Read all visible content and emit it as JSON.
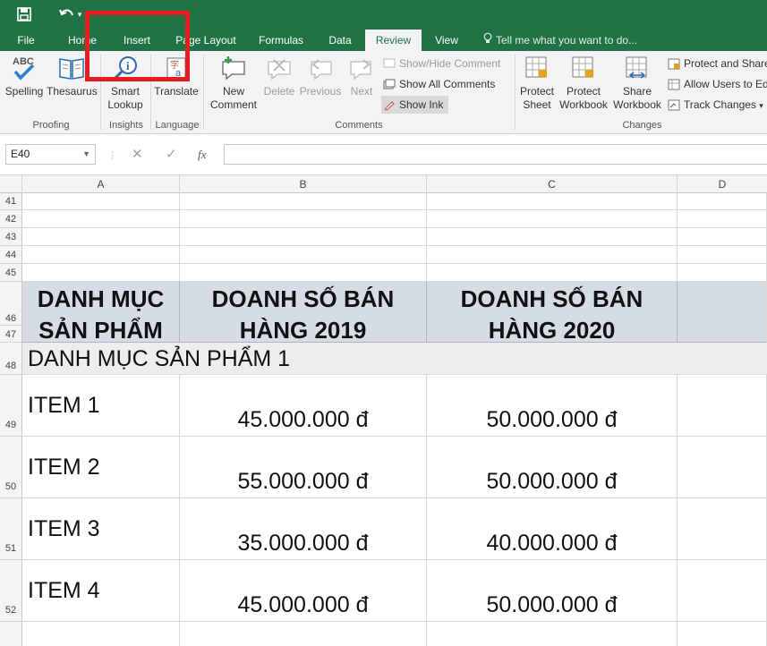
{
  "title_bar": {
    "save_icon": "save-icon",
    "undo_icon": "undo-icon"
  },
  "tabs": [
    {
      "label": "File"
    },
    {
      "label": "Home"
    },
    {
      "label": "Insert"
    },
    {
      "label": "Page Layout"
    },
    {
      "label": "Formulas"
    },
    {
      "label": "Data"
    },
    {
      "label": "Review"
    },
    {
      "label": "View"
    }
  ],
  "tell_me": "Tell me what you want to do...",
  "ribbon": {
    "proofing": {
      "label": "Proofing",
      "spelling": "Spelling",
      "thesaurus": "Thesaurus"
    },
    "insights": {
      "label": "Insights",
      "smart_lookup_1": "Smart",
      "smart_lookup_2": "Lookup"
    },
    "language": {
      "label": "Language",
      "translate": "Translate"
    },
    "comments": {
      "label": "Comments",
      "new_comment_1": "New",
      "new_comment_2": "Comment",
      "delete": "Delete",
      "previous": "Previous",
      "next": "Next",
      "show_hide": "Show/Hide Comment",
      "show_all": "Show All Comments",
      "show_ink": "Show Ink"
    },
    "changes": {
      "label": "Changes",
      "protect_sheet_1": "Protect",
      "protect_sheet_2": "Sheet",
      "protect_workbook_1": "Protect",
      "protect_workbook_2": "Workbook",
      "share_workbook_1": "Share",
      "share_workbook_2": "Workbook",
      "protect_share": "Protect and Share",
      "allow_users": "Allow Users to Edi",
      "track_changes": "Track Changes"
    }
  },
  "formula_bar": {
    "name_box": "E40",
    "fx": "fx",
    "cancel": "✕",
    "enter": "✓",
    "formula": ""
  },
  "columns": [
    "A",
    "B",
    "C",
    "D"
  ],
  "rows": [
    "41",
    "42",
    "43",
    "44",
    "45",
    "46",
    "47",
    "48",
    "49",
    "50",
    "51",
    "52"
  ],
  "sheet": {
    "header": {
      "a_line1": "DANH MỤC",
      "a_line2": "SẢN PHẨM",
      "b_line1": "DOANH SỐ BÁN",
      "b_line2": "HÀNG 2019",
      "c_line1": "DOANH SỐ BÁN",
      "c_line2": "HÀNG 2020"
    },
    "category": "DANH MỤC SẢN PHẨM 1",
    "items": [
      {
        "name": "ITEM 1",
        "sales_2019": "45.000.000 đ",
        "sales_2020": "50.000.000 đ"
      },
      {
        "name": "ITEM 2",
        "sales_2019": "55.000.000 đ",
        "sales_2020": "50.000.000 đ"
      },
      {
        "name": "ITEM 3",
        "sales_2019": "35.000.000 đ",
        "sales_2020": "40.000.000 đ"
      },
      {
        "name": "ITEM 4",
        "sales_2019": "45.000.000 đ",
        "sales_2020": "50.000.000 đ"
      }
    ]
  },
  "colors": {
    "excel_green": "#217346",
    "header_fill": "#d6dce4",
    "category_fill": "#ededed",
    "highlight_red": "#e61e24"
  }
}
